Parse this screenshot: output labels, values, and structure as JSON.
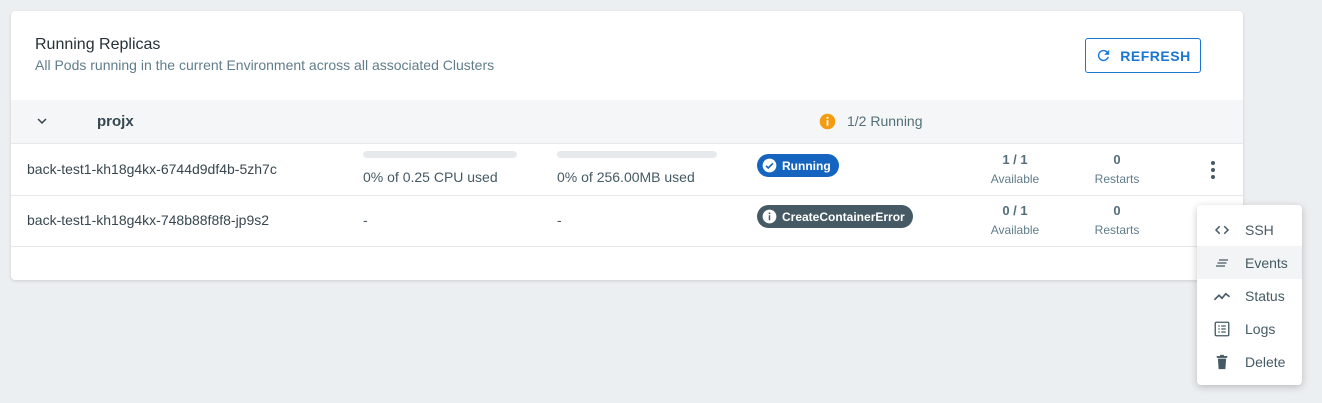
{
  "card": {
    "title": "Running Replicas",
    "subtitle": "All Pods running in the current Environment across all associated Clusters",
    "refresh_label": "REFRESH"
  },
  "group": {
    "name": "projx",
    "status": "1/2 Running",
    "warn_icon": "info-circle-icon",
    "warn_color": "#f39c12"
  },
  "pods": [
    {
      "name": "back-test1-kh18g4kx-6744d9df4b-5zh7c",
      "cpu_usage": "0% of 0.25 CPU used",
      "cpu_fraction": 0,
      "mem_usage": "0% of 256.00MB used",
      "mem_fraction": 0,
      "status": "Running",
      "status_icon": "check-circle-icon",
      "available_value": "1 / 1",
      "available_label": "Available",
      "restarts_value": "0",
      "restarts_label": "Restarts"
    },
    {
      "name": "back-test1-kh18g4kx-748b88f8f8-jp9s2",
      "cpu_usage": "-",
      "mem_usage": "-",
      "status": "CreateContainerError",
      "status_icon": "info-circle-icon",
      "available_value": "0 / 1",
      "available_label": "Available",
      "restarts_value": "0",
      "restarts_label": "Restarts"
    }
  ],
  "menu": {
    "items": [
      {
        "label": "SSH",
        "icon": "code-icon"
      },
      {
        "label": "Events",
        "icon": "notes-icon"
      },
      {
        "label": "Status",
        "icon": "trend-line-icon"
      },
      {
        "label": "Logs",
        "icon": "list-icon"
      },
      {
        "label": "Delete",
        "icon": "trash-icon"
      }
    ]
  },
  "colors": {
    "accent": "#1976d2",
    "running_badge": "#1565c0",
    "error_badge": "#455a64",
    "background": "#eceff1"
  }
}
